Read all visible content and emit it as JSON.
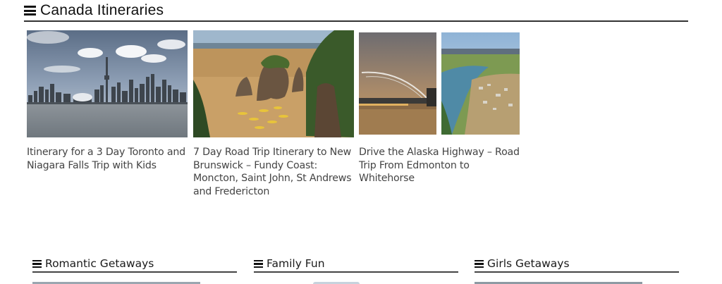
{
  "section": {
    "title": "Canada Itineraries",
    "icon": "menu-icon"
  },
  "cards": [
    {
      "title": "Itinerary for a 3 Day Toronto and Niagara Falls Trip with Kids",
      "image": "toronto-skyline"
    },
    {
      "title": "7 Day Road Trip Itinerary to New Brunswick – Fundy Coast: Moncton, Saint John, St Andrews and Fredericton",
      "image": "hopewell-rocks-kayaks"
    },
    {
      "title": "Drive the Alaska Highway – Road Trip From Edmonton to Whitehorse",
      "image": "edmonton-bridge-and-whitehorse-aerial"
    }
  ],
  "categories": [
    {
      "label": "Romantic Getaways",
      "icon": "menu-icon"
    },
    {
      "label": "Family Fun",
      "icon": "menu-icon"
    },
    {
      "label": "Girls Getaways",
      "icon": "menu-icon"
    }
  ],
  "colors": {
    "text": "#1a1a1a",
    "card_title": "#444444",
    "rule": "#333333"
  }
}
